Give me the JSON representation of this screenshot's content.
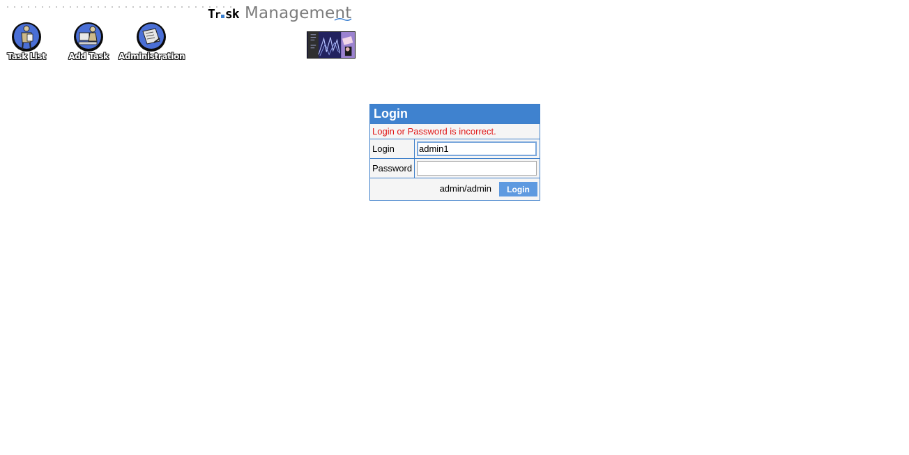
{
  "header": {
    "brand_task": "Task",
    "brand_management": "Management"
  },
  "nav": {
    "task_list": "Task List",
    "add_task": "Add Task",
    "administration": "Administration"
  },
  "login": {
    "title": "Login",
    "error": "Login or Password is incorrect.",
    "login_label": "Login",
    "login_value": "admin1",
    "password_label": "Password",
    "password_value": "",
    "hint": "admin/admin",
    "button": "Login"
  },
  "colors": {
    "accent": "#3f82cf",
    "error": "#e01515",
    "button": "#5e9ae0"
  }
}
